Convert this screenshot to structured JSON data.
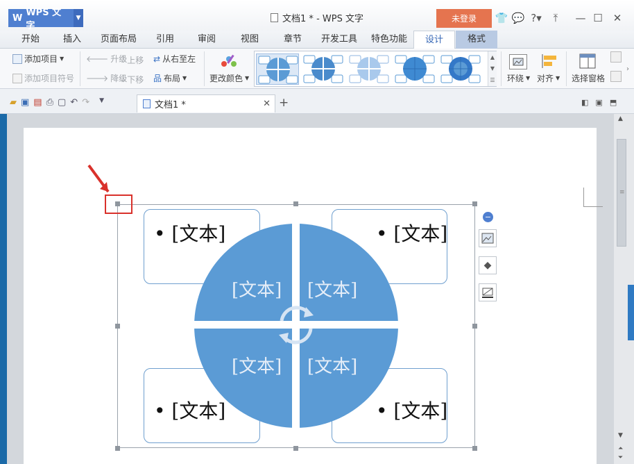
{
  "app": {
    "name": "WPS 文字",
    "window_title": "文档1 * - WPS 文字",
    "login": "未登录"
  },
  "tabs": [
    "开始",
    "插入",
    "页面布局",
    "引用",
    "审阅",
    "视图",
    "章节",
    "开发工具",
    "特色功能",
    "设计",
    "格式"
  ],
  "ribbon": {
    "add_item": "添加项目",
    "add_bullet": "添加项目符号",
    "promote": "升级",
    "demote": "降级",
    "move_up": "上移",
    "move_down": "下移",
    "rtl": "从右至左",
    "layout": "布局",
    "change_color": "更改颜色",
    "wrap": "环绕",
    "align": "对齐",
    "select_pane": "选择窗格"
  },
  "document": {
    "tab_title": "文档1 *"
  },
  "diagram": {
    "placeholder": "[文本]",
    "bullet": "•",
    "accent_color": "#5b9bd5",
    "border_color": "#6f9fcf"
  }
}
